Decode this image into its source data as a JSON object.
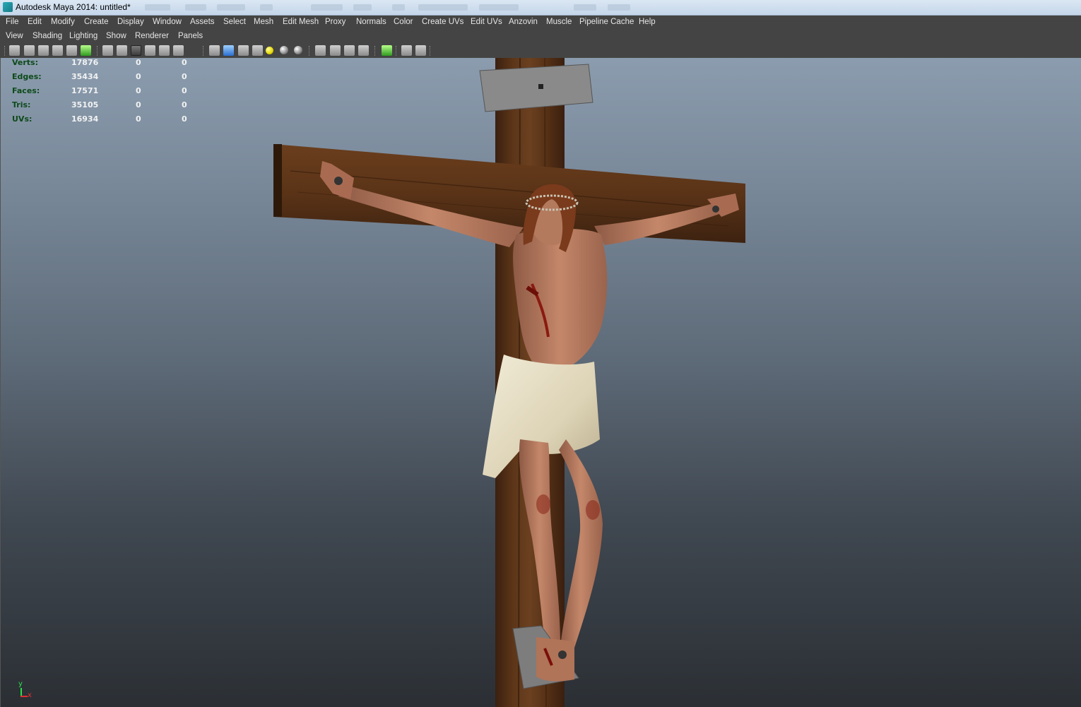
{
  "window": {
    "title": "Autodesk Maya 2014: untitled*"
  },
  "menus": {
    "main": [
      "File",
      "Edit",
      "Modify",
      "Create",
      "Display",
      "Window",
      "Assets",
      "Select",
      "Mesh",
      "Edit Mesh",
      "Proxy",
      "Normals",
      "Color",
      "Create UVs",
      "Edit UVs",
      "Anzovin",
      "Muscle",
      "Pipeline Cache",
      "Help"
    ],
    "panel": [
      "View",
      "Shading",
      "Lighting",
      "Show",
      "Renderer",
      "Panels"
    ]
  },
  "toolbar": {
    "icons": [
      "select-camera-icon",
      "camera-attributes-icon",
      "bookmark-icon",
      "image-plane-icon",
      "2d-pan-zoom-icon",
      "grease-pencil-icon",
      "grid-icon",
      "film-gate-icon",
      "resolution-gate-icon",
      "gate-mask-icon",
      "field-chart-icon",
      "safe-title-icon",
      "wireframe-icon",
      "smooth-shade-icon",
      "wireframe-on-shaded-icon",
      "textured-icon",
      "use-all-lights-icon",
      "shadows-icon",
      "screen-space-ao-icon",
      "motion-blur-icon",
      "multisample-aa-icon",
      "depth-of-field-icon",
      "isolate-select-icon",
      "xray-icon",
      "xray-active-components-icon",
      "xray-joints-icon"
    ]
  },
  "hud": {
    "rows": [
      {
        "label": "Verts:",
        "values": [
          "17876",
          "0",
          "0"
        ]
      },
      {
        "label": "Edges:",
        "values": [
          "35434",
          "0",
          "0"
        ]
      },
      {
        "label": "Faces:",
        "values": [
          "17571",
          "0",
          "0"
        ]
      },
      {
        "label": "Tris:",
        "values": [
          "35105",
          "0",
          "0"
        ]
      },
      {
        "label": "UVs:",
        "values": [
          "16934",
          "0",
          "0"
        ]
      }
    ]
  },
  "axis": {
    "y": "y",
    "x": "x"
  },
  "colors": {
    "hud_label": "#0e4a1a",
    "hud_value": "#f2f2f2",
    "menu_bg": "#444444",
    "wood": "#5a3418",
    "cloth": "#e3dcc4",
    "skin": "#b87a5e"
  }
}
